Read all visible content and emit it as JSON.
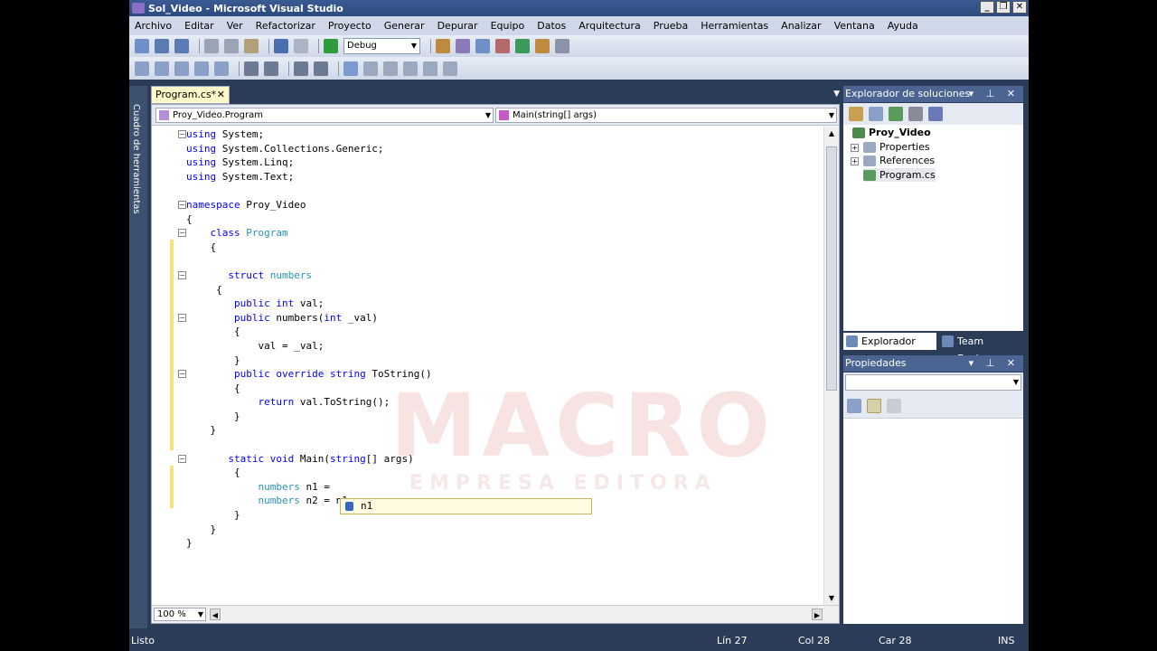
{
  "window": {
    "title": "Sol_Video - Microsoft Visual Studio"
  },
  "menu": [
    "Archivo",
    "Editar",
    "Ver",
    "Refactorizar",
    "Proyecto",
    "Generar",
    "Depurar",
    "Equipo",
    "Datos",
    "Arquitectura",
    "Prueba",
    "Herramientas",
    "Analizar",
    "Ventana",
    "Ayuda"
  ],
  "toolbar": {
    "config": "Debug"
  },
  "toolbox": {
    "label": "Cuadro de herramientas"
  },
  "editor": {
    "tab": "Program.cs*",
    "nav_left": "Proy_Video.Program",
    "nav_right": "Main(string[] args)",
    "zoom": "100 %",
    "intellisense": "n1",
    "watermark": "MACRO",
    "watermark_sub": "EMPRESA EDITORA"
  },
  "code": [
    [
      [
        "kw",
        "using"
      ],
      [
        "pl",
        " System;"
      ]
    ],
    [
      [
        "kw",
        "using"
      ],
      [
        "pl",
        " System.Collections.Generic;"
      ]
    ],
    [
      [
        "kw",
        "using"
      ],
      [
        "pl",
        " System.Linq;"
      ]
    ],
    [
      [
        "kw",
        "using"
      ],
      [
        "pl",
        " System.Text;"
      ]
    ],
    [
      [
        "pl",
        ""
      ]
    ],
    [
      [
        "kw",
        "namespace"
      ],
      [
        "pl",
        " Proy_Video"
      ]
    ],
    [
      [
        "pl",
        "{"
      ]
    ],
    [
      [
        "pl",
        "    "
      ],
      [
        "kw",
        "class"
      ],
      [
        "pl",
        " "
      ],
      [
        "ty",
        "Program"
      ]
    ],
    [
      [
        "pl",
        "    {"
      ]
    ],
    [
      [
        "pl",
        ""
      ]
    ],
    [
      [
        "pl",
        "       "
      ],
      [
        "kw",
        "struct"
      ],
      [
        "pl",
        " "
      ],
      [
        "ty",
        "numbers"
      ]
    ],
    [
      [
        "pl",
        "     {"
      ]
    ],
    [
      [
        "pl",
        "        "
      ],
      [
        "kw",
        "public"
      ],
      [
        "pl",
        " "
      ],
      [
        "kw",
        "int"
      ],
      [
        "pl",
        " val;"
      ]
    ],
    [
      [
        "pl",
        "        "
      ],
      [
        "kw",
        "public"
      ],
      [
        "pl",
        " numbers("
      ],
      [
        "kw",
        "int"
      ],
      [
        "pl",
        " _val)"
      ]
    ],
    [
      [
        "pl",
        "        {"
      ]
    ],
    [
      [
        "pl",
        "            val = _val;"
      ]
    ],
    [
      [
        "pl",
        "        }"
      ]
    ],
    [
      [
        "pl",
        "        "
      ],
      [
        "kw",
        "public"
      ],
      [
        "pl",
        " "
      ],
      [
        "kw",
        "override"
      ],
      [
        "pl",
        " "
      ],
      [
        "kw",
        "string"
      ],
      [
        "pl",
        " ToString()"
      ]
    ],
    [
      [
        "pl",
        "        {"
      ]
    ],
    [
      [
        "pl",
        "            "
      ],
      [
        "kw",
        "return"
      ],
      [
        "pl",
        " val.ToString();"
      ]
    ],
    [
      [
        "pl",
        "        }"
      ]
    ],
    [
      [
        "pl",
        "    }"
      ]
    ],
    [
      [
        "pl",
        ""
      ]
    ],
    [
      [
        "pl",
        "       "
      ],
      [
        "kw",
        "static"
      ],
      [
        "pl",
        " "
      ],
      [
        "kw",
        "void"
      ],
      [
        "pl",
        " Main("
      ],
      [
        "kw",
        "string"
      ],
      [
        "pl",
        "[] args)"
      ]
    ],
    [
      [
        "pl",
        "        {"
      ]
    ],
    [
      [
        "pl",
        "            "
      ],
      [
        "ty",
        "numbers"
      ],
      [
        "pl",
        " n1 ="
      ]
    ],
    [
      [
        "pl",
        "            "
      ],
      [
        "ty",
        "numbers"
      ],
      [
        "pl",
        " n2 = n1"
      ]
    ],
    [
      [
        "pl",
        "        }"
      ]
    ],
    [
      [
        "pl",
        "    }"
      ]
    ],
    [
      [
        "pl",
        "}"
      ]
    ]
  ],
  "solution_explorer": {
    "title": "Explorador de soluciones",
    "project": "Proy_Video",
    "items": [
      "Properties",
      "References",
      "Program.cs"
    ],
    "tabs": [
      "Explorador de...",
      "Team Explorer"
    ]
  },
  "properties": {
    "title": "Propiedades"
  },
  "status": {
    "ready": "Listo",
    "line": "Lín 27",
    "col": "Col 28",
    "char": "Car 28",
    "mode": "INS"
  },
  "colors": {
    "chrome": "#2b3c59",
    "panel_header": "#4c6491",
    "keyword": "#0000ff",
    "type": "#2b91af",
    "change_bar": "#f5e27a"
  }
}
